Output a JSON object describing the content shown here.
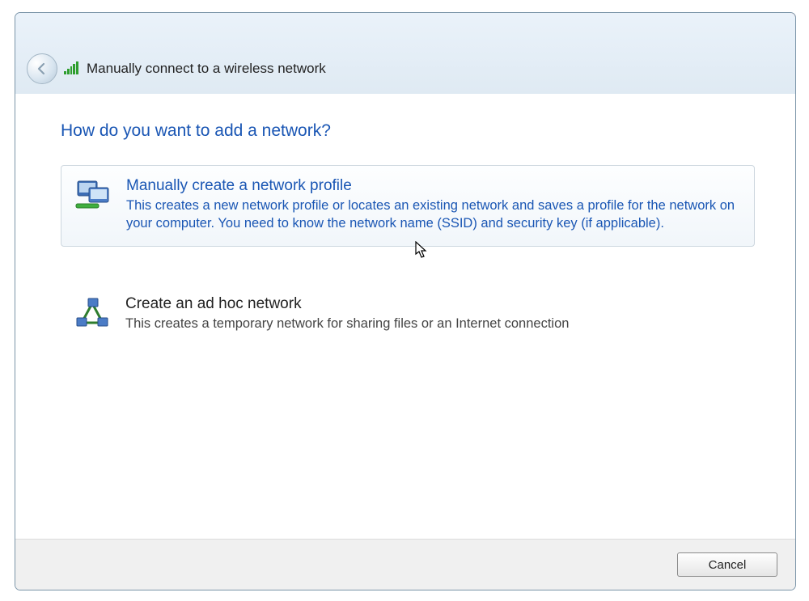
{
  "header": {
    "title": "Manually connect to a wireless network"
  },
  "main": {
    "heading": "How do you want to add a network?",
    "options": [
      {
        "title": "Manually create a network profile",
        "description": "This creates a new network profile or locates an existing network and saves a profile for the network on your computer. You need to know the network name (SSID) and security key (if applicable)."
      },
      {
        "title": "Create an ad hoc network",
        "description": "This creates a temporary network for sharing files or an Internet connection"
      }
    ]
  },
  "footer": {
    "cancel": "Cancel"
  }
}
